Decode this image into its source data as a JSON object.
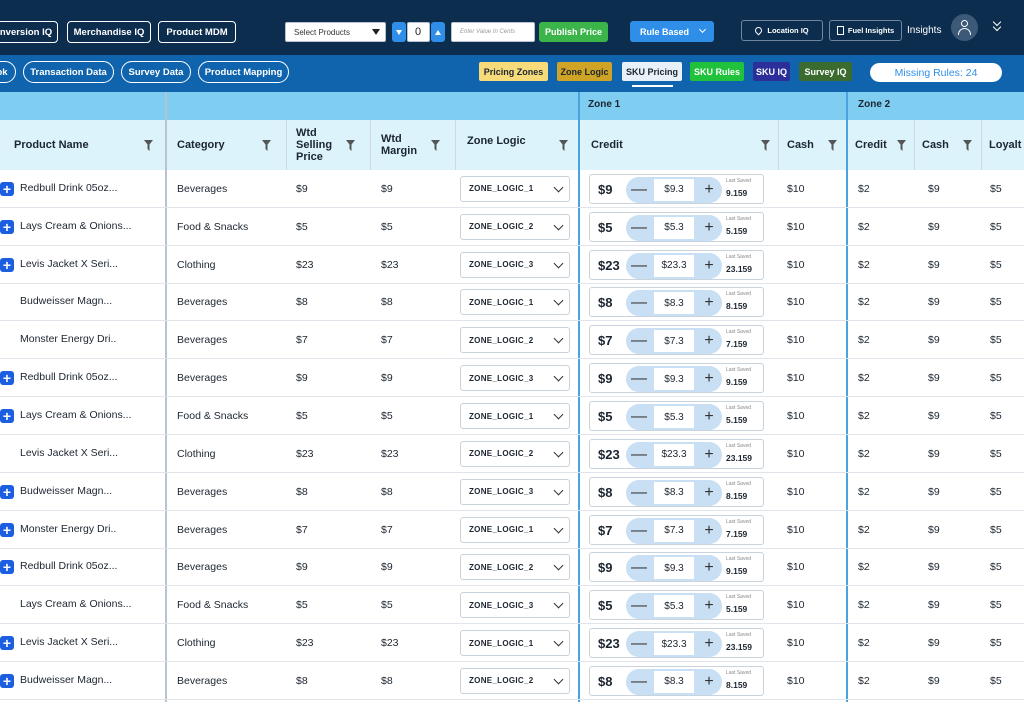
{
  "topbar": {
    "nav_buttons": [
      "nversion IQ",
      "Merchandise IQ",
      "Product MDM"
    ],
    "select_products": "Select Products",
    "stepper_value": "0",
    "cents_placeholder": "Enter Value In Cents",
    "publish_label": "Publish Price",
    "rule_label": "Rule Based",
    "location_label": "Location IQ",
    "fuel_label": "Fuel Insights",
    "insights_label": "Insights"
  },
  "subbar": {
    "left_pills": [
      "ok",
      "Transaction Data",
      "Survey Data",
      "Product Mapping"
    ],
    "tags": [
      "Pricing Zones",
      "Zone Logic",
      "SKU Pricing",
      "SKU Rules",
      "SKU IQ",
      "Survey IQ"
    ],
    "missing_rules": "Missing Rules: 24"
  },
  "colors": {
    "topbar": "#0c2d4e",
    "subbar": "#0f64ad",
    "header": "#dcf3fc",
    "zonebar": "#7fcdf0",
    "publish": "#3bb54a",
    "rule": "#2f8fe8",
    "plus": "#1b5fe0"
  },
  "zones": [
    "Zone 1",
    "Zone 2"
  ],
  "columns": {
    "product": "Product Name",
    "category": "Category",
    "wsp": "Wtd Selling Price",
    "wm": "Wtd Margin",
    "zl": "Zone Logic",
    "credit": "Credit",
    "cash": "Cash",
    "credit2": "Credit",
    "cash2": "Cash",
    "loyalty": "Loyalt"
  },
  "last_saved_label": "Last Saved",
  "rows": [
    {
      "plus": true,
      "name": "Redbull Drink 05oz...",
      "category": "Beverages",
      "wsp": "$9",
      "wm": "$9",
      "zl": "ZONE_LOGIC_1",
      "credit": "$9",
      "step": "$9.3",
      "saved": "9.159",
      "cash": "$10",
      "z2credit": "$2",
      "z2cash": "$9",
      "loyalty": "$5"
    },
    {
      "plus": true,
      "name": "Lays Cream & Onions...",
      "category": "Food & Snacks",
      "wsp": "$5",
      "wm": "$5",
      "zl": "ZONE_LOGIC_2",
      "credit": "$5",
      "step": "$5.3",
      "saved": "5.159",
      "cash": "$10",
      "z2credit": "$2",
      "z2cash": "$9",
      "loyalty": "$5"
    },
    {
      "plus": true,
      "name": "Levis Jacket X Seri...",
      "category": "Clothing",
      "wsp": "$23",
      "wm": "$23",
      "zl": "ZONE_LOGIC_3",
      "credit": "$23",
      "step": "$23.3",
      "saved": "23.159",
      "cash": "$10",
      "z2credit": "$2",
      "z2cash": "$9",
      "loyalty": "$5"
    },
    {
      "plus": false,
      "name": "Budweisser Magn...",
      "category": "Beverages",
      "wsp": "$8",
      "wm": "$8",
      "zl": "ZONE_LOGIC_1",
      "credit": "$8",
      "step": "$8.3",
      "saved": "8.159",
      "cash": "$10",
      "z2credit": "$2",
      "z2cash": "$9",
      "loyalty": "$5"
    },
    {
      "plus": false,
      "name": "Monster Energy Dri..",
      "category": "Beverages",
      "wsp": "$7",
      "wm": "$7",
      "zl": "ZONE_LOGIC_2",
      "credit": "$7",
      "step": "$7.3",
      "saved": "7.159",
      "cash": "$10",
      "z2credit": "$2",
      "z2cash": "$9",
      "loyalty": "$5"
    },
    {
      "plus": true,
      "name": "Redbull Drink 05oz...",
      "category": "Beverages",
      "wsp": "$9",
      "wm": "$9",
      "zl": "ZONE_LOGIC_3",
      "credit": "$9",
      "step": "$9.3",
      "saved": "9.159",
      "cash": "$10",
      "z2credit": "$2",
      "z2cash": "$9",
      "loyalty": "$5"
    },
    {
      "plus": true,
      "name": "Lays Cream & Onions...",
      "category": "Food & Snacks",
      "wsp": "$5",
      "wm": "$5",
      "zl": "ZONE_LOGIC_1",
      "credit": "$5",
      "step": "$5.3",
      "saved": "5.159",
      "cash": "$10",
      "z2credit": "$2",
      "z2cash": "$9",
      "loyalty": "$5"
    },
    {
      "plus": false,
      "name": "Levis Jacket X Seri...",
      "category": "Clothing",
      "wsp": "$23",
      "wm": "$23",
      "zl": "ZONE_LOGIC_2",
      "credit": "$23",
      "step": "$23.3",
      "saved": "23.159",
      "cash": "$10",
      "z2credit": "$2",
      "z2cash": "$9",
      "loyalty": "$5"
    },
    {
      "plus": true,
      "name": "Budweisser Magn...",
      "category": "Beverages",
      "wsp": "$8",
      "wm": "$8",
      "zl": "ZONE_LOGIC_3",
      "credit": "$8",
      "step": "$8.3",
      "saved": "8.159",
      "cash": "$10",
      "z2credit": "$2",
      "z2cash": "$9",
      "loyalty": "$5"
    },
    {
      "plus": true,
      "name": "Monster Energy Dri..",
      "category": "Beverages",
      "wsp": "$7",
      "wm": "$7",
      "zl": "ZONE_LOGIC_1",
      "credit": "$7",
      "step": "$7.3",
      "saved": "7.159",
      "cash": "$10",
      "z2credit": "$2",
      "z2cash": "$9",
      "loyalty": "$5"
    },
    {
      "plus": true,
      "name": "Redbull Drink 05oz...",
      "category": "Beverages",
      "wsp": "$9",
      "wm": "$9",
      "zl": "ZONE_LOGIC_2",
      "credit": "$9",
      "step": "$9.3",
      "saved": "9.159",
      "cash": "$10",
      "z2credit": "$2",
      "z2cash": "$9",
      "loyalty": "$5"
    },
    {
      "plus": false,
      "name": "Lays Cream & Onions...",
      "category": "Food & Snacks",
      "wsp": "$5",
      "wm": "$5",
      "zl": "ZONE_LOGIC_3",
      "credit": "$5",
      "step": "$5.3",
      "saved": "5.159",
      "cash": "$10",
      "z2credit": "$2",
      "z2cash": "$9",
      "loyalty": "$5"
    },
    {
      "plus": true,
      "name": "Levis Jacket X Seri...",
      "category": "Clothing",
      "wsp": "$23",
      "wm": "$23",
      "zl": "ZONE_LOGIC_1",
      "credit": "$23",
      "step": "$23.3",
      "saved": "23.159",
      "cash": "$10",
      "z2credit": "$2",
      "z2cash": "$9",
      "loyalty": "$5"
    },
    {
      "plus": true,
      "name": "Budweisser Magn...",
      "category": "Beverages",
      "wsp": "$8",
      "wm": "$8",
      "zl": "ZONE_LOGIC_2",
      "credit": "$8",
      "step": "$8.3",
      "saved": "8.159",
      "cash": "$10",
      "z2credit": "$2",
      "z2cash": "$9",
      "loyalty": "$5"
    }
  ]
}
